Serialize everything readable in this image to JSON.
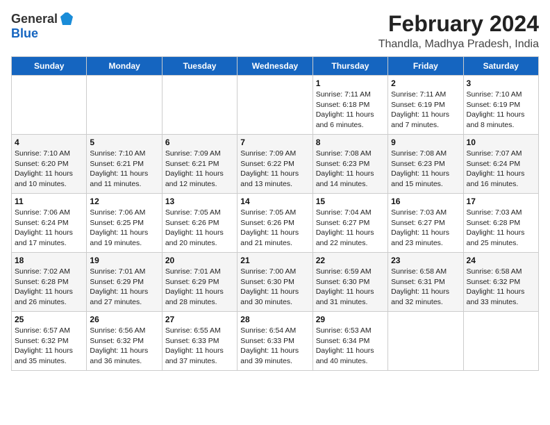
{
  "header": {
    "logo_general": "General",
    "logo_blue": "Blue",
    "title": "February 2024",
    "subtitle": "Thandla, Madhya Pradesh, India"
  },
  "days_of_week": [
    "Sunday",
    "Monday",
    "Tuesday",
    "Wednesday",
    "Thursday",
    "Friday",
    "Saturday"
  ],
  "weeks": [
    [
      {
        "day": "",
        "info": ""
      },
      {
        "day": "",
        "info": ""
      },
      {
        "day": "",
        "info": ""
      },
      {
        "day": "",
        "info": ""
      },
      {
        "day": "1",
        "info": "Sunrise: 7:11 AM\nSunset: 6:18 PM\nDaylight: 11 hours\nand 6 minutes."
      },
      {
        "day": "2",
        "info": "Sunrise: 7:11 AM\nSunset: 6:19 PM\nDaylight: 11 hours\nand 7 minutes."
      },
      {
        "day": "3",
        "info": "Sunrise: 7:10 AM\nSunset: 6:19 PM\nDaylight: 11 hours\nand 8 minutes."
      }
    ],
    [
      {
        "day": "4",
        "info": "Sunrise: 7:10 AM\nSunset: 6:20 PM\nDaylight: 11 hours\nand 10 minutes."
      },
      {
        "day": "5",
        "info": "Sunrise: 7:10 AM\nSunset: 6:21 PM\nDaylight: 11 hours\nand 11 minutes."
      },
      {
        "day": "6",
        "info": "Sunrise: 7:09 AM\nSunset: 6:21 PM\nDaylight: 11 hours\nand 12 minutes."
      },
      {
        "day": "7",
        "info": "Sunrise: 7:09 AM\nSunset: 6:22 PM\nDaylight: 11 hours\nand 13 minutes."
      },
      {
        "day": "8",
        "info": "Sunrise: 7:08 AM\nSunset: 6:23 PM\nDaylight: 11 hours\nand 14 minutes."
      },
      {
        "day": "9",
        "info": "Sunrise: 7:08 AM\nSunset: 6:23 PM\nDaylight: 11 hours\nand 15 minutes."
      },
      {
        "day": "10",
        "info": "Sunrise: 7:07 AM\nSunset: 6:24 PM\nDaylight: 11 hours\nand 16 minutes."
      }
    ],
    [
      {
        "day": "11",
        "info": "Sunrise: 7:06 AM\nSunset: 6:24 PM\nDaylight: 11 hours\nand 17 minutes."
      },
      {
        "day": "12",
        "info": "Sunrise: 7:06 AM\nSunset: 6:25 PM\nDaylight: 11 hours\nand 19 minutes."
      },
      {
        "day": "13",
        "info": "Sunrise: 7:05 AM\nSunset: 6:26 PM\nDaylight: 11 hours\nand 20 minutes."
      },
      {
        "day": "14",
        "info": "Sunrise: 7:05 AM\nSunset: 6:26 PM\nDaylight: 11 hours\nand 21 minutes."
      },
      {
        "day": "15",
        "info": "Sunrise: 7:04 AM\nSunset: 6:27 PM\nDaylight: 11 hours\nand 22 minutes."
      },
      {
        "day": "16",
        "info": "Sunrise: 7:03 AM\nSunset: 6:27 PM\nDaylight: 11 hours\nand 23 minutes."
      },
      {
        "day": "17",
        "info": "Sunrise: 7:03 AM\nSunset: 6:28 PM\nDaylight: 11 hours\nand 25 minutes."
      }
    ],
    [
      {
        "day": "18",
        "info": "Sunrise: 7:02 AM\nSunset: 6:28 PM\nDaylight: 11 hours\nand 26 minutes."
      },
      {
        "day": "19",
        "info": "Sunrise: 7:01 AM\nSunset: 6:29 PM\nDaylight: 11 hours\nand 27 minutes."
      },
      {
        "day": "20",
        "info": "Sunrise: 7:01 AM\nSunset: 6:29 PM\nDaylight: 11 hours\nand 28 minutes."
      },
      {
        "day": "21",
        "info": "Sunrise: 7:00 AM\nSunset: 6:30 PM\nDaylight: 11 hours\nand 30 minutes."
      },
      {
        "day": "22",
        "info": "Sunrise: 6:59 AM\nSunset: 6:30 PM\nDaylight: 11 hours\nand 31 minutes."
      },
      {
        "day": "23",
        "info": "Sunrise: 6:58 AM\nSunset: 6:31 PM\nDaylight: 11 hours\nand 32 minutes."
      },
      {
        "day": "24",
        "info": "Sunrise: 6:58 AM\nSunset: 6:32 PM\nDaylight: 11 hours\nand 33 minutes."
      }
    ],
    [
      {
        "day": "25",
        "info": "Sunrise: 6:57 AM\nSunset: 6:32 PM\nDaylight: 11 hours\nand 35 minutes."
      },
      {
        "day": "26",
        "info": "Sunrise: 6:56 AM\nSunset: 6:32 PM\nDaylight: 11 hours\nand 36 minutes."
      },
      {
        "day": "27",
        "info": "Sunrise: 6:55 AM\nSunset: 6:33 PM\nDaylight: 11 hours\nand 37 minutes."
      },
      {
        "day": "28",
        "info": "Sunrise: 6:54 AM\nSunset: 6:33 PM\nDaylight: 11 hours\nand 39 minutes."
      },
      {
        "day": "29",
        "info": "Sunrise: 6:53 AM\nSunset: 6:34 PM\nDaylight: 11 hours\nand 40 minutes."
      },
      {
        "day": "",
        "info": ""
      },
      {
        "day": "",
        "info": ""
      }
    ]
  ]
}
